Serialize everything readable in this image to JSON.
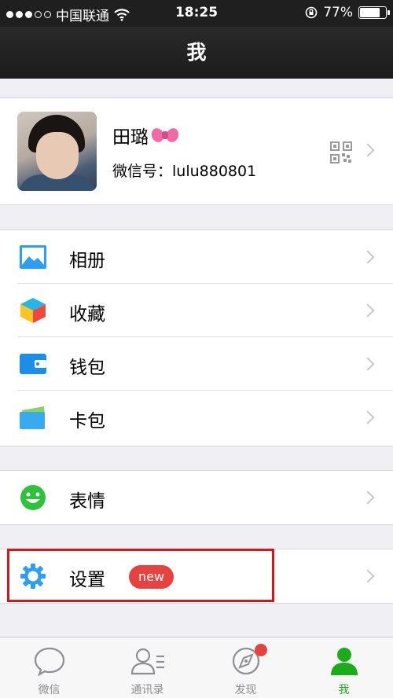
{
  "status_bar": {
    "carrier": "中国联通",
    "time": "18:25",
    "battery_text": "77%",
    "battery_level": 0.77
  },
  "nav": {
    "title": "我"
  },
  "profile": {
    "name": "田璐",
    "wechat_id": "微信号：lulu880801"
  },
  "menu": {
    "album": "相册",
    "favorites": "收藏",
    "wallet": "钱包",
    "cards": "卡包",
    "stickers": "表情",
    "settings": "设置",
    "settings_badge": "new"
  },
  "tabs": [
    {
      "label": "微信",
      "icon": "chat-bubble-icon"
    },
    {
      "label": "通讯录",
      "icon": "contacts-icon"
    },
    {
      "label": "发现",
      "icon": "compass-icon"
    },
    {
      "label": "我",
      "icon": "person-icon"
    }
  ],
  "colors": {
    "accent_green": "#1aad19",
    "badge_red": "#e64340",
    "highlight_red": "#d9141b",
    "nav_bg": "#1f1f1f"
  }
}
